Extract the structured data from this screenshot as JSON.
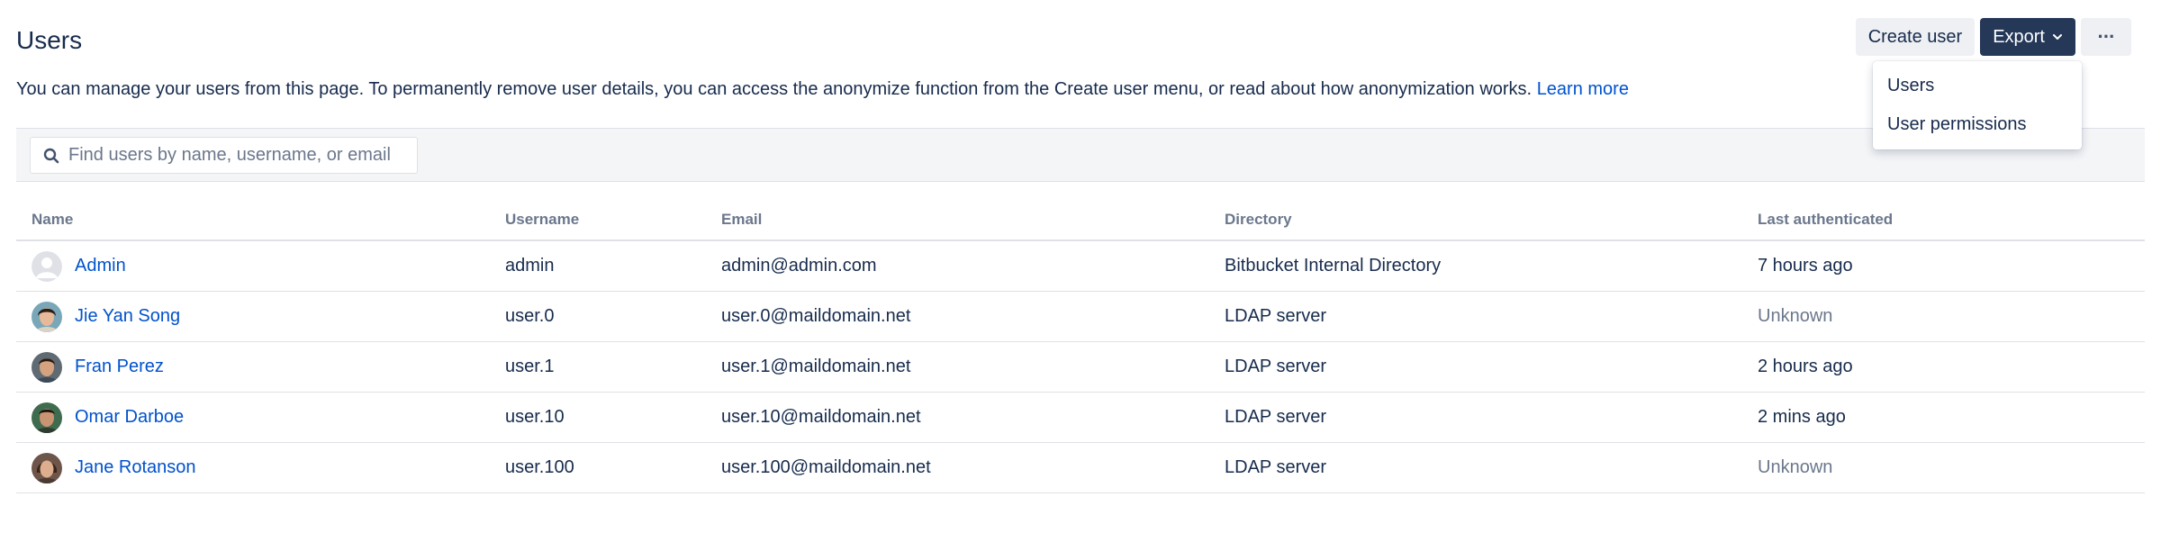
{
  "header": {
    "title": "Users",
    "description": "You can manage your users from this page. To permanently remove user details, you can access the anonymize function from the Create user menu, or read about how anonymization works.",
    "learn_more": "Learn more"
  },
  "actions": {
    "create_user": "Create user",
    "export": "Export",
    "more": "···"
  },
  "export_menu": {
    "items": [
      "Users",
      "User permissions"
    ]
  },
  "search": {
    "placeholder": "Find users by name, username, or email",
    "value": ""
  },
  "table": {
    "columns": [
      "Name",
      "Username",
      "Email",
      "Directory",
      "Last authenticated"
    ],
    "rows": [
      {
        "name": "Admin",
        "username": "admin",
        "email": "admin@admin.com",
        "directory": "Bitbucket Internal Directory",
        "last": "7 hours ago",
        "avatar": "default-avatar-icon"
      },
      {
        "name": "Jie Yan Song",
        "username": "user.0",
        "email": "user.0@maildomain.net",
        "directory": "LDAP server",
        "last": "Unknown",
        "avatar": "user-photo"
      },
      {
        "name": "Fran Perez",
        "username": "user.1",
        "email": "user.1@maildomain.net",
        "directory": "LDAP server",
        "last": "2 hours ago",
        "avatar": "user-photo"
      },
      {
        "name": "Omar Darboe",
        "username": "user.10",
        "email": "user.10@maildomain.net",
        "directory": "LDAP server",
        "last": "2 mins ago",
        "avatar": "user-photo"
      },
      {
        "name": "Jane Rotanson",
        "username": "user.100",
        "email": "user.100@maildomain.net",
        "directory": "LDAP server",
        "last": "Unknown",
        "avatar": "user-photo"
      }
    ]
  },
  "colors": {
    "link": "#0052cc",
    "primary_button": "#253858",
    "muted_text": "#6b778c"
  }
}
